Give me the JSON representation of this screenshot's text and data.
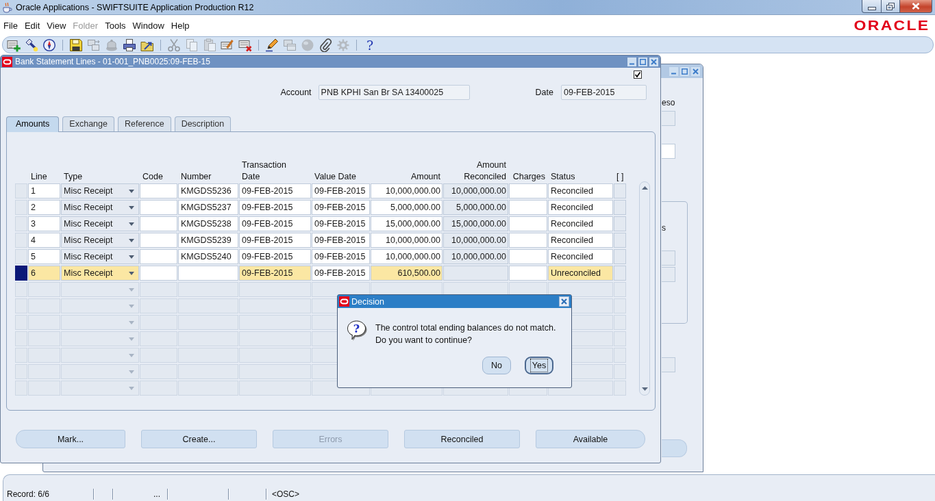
{
  "window": {
    "title": "Oracle Applications - SWIFTSUITE Application Production R12"
  },
  "menu": [
    {
      "label": "File",
      "disabled": false
    },
    {
      "label": "Edit",
      "disabled": false
    },
    {
      "label": "View",
      "disabled": false
    },
    {
      "label": "Folder",
      "disabled": true
    },
    {
      "label": "Tools",
      "disabled": false
    },
    {
      "label": "Window",
      "disabled": false
    },
    {
      "label": "Help",
      "disabled": false
    }
  ],
  "brand": "ORACLE",
  "toolbar": [
    {
      "buttons": [
        {
          "kind": "new",
          "disabled": false
        },
        {
          "kind": "find",
          "disabled": false
        },
        {
          "kind": "navigator",
          "disabled": false
        }
      ]
    },
    {
      "buttons": [
        {
          "kind": "save",
          "disabled": false
        },
        {
          "kind": "step",
          "disabled": true
        },
        {
          "kind": "responsibility",
          "disabled": true
        },
        {
          "kind": "print",
          "disabled": false
        },
        {
          "kind": "close",
          "disabled": false
        }
      ]
    },
    {
      "buttons": [
        {
          "kind": "cut",
          "disabled": true
        },
        {
          "kind": "copy",
          "disabled": true
        },
        {
          "kind": "paste",
          "disabled": true
        },
        {
          "kind": "clear",
          "disabled": false
        },
        {
          "kind": "delete",
          "disabled": false
        }
      ]
    },
    {
      "buttons": [
        {
          "kind": "edit",
          "disabled": false
        },
        {
          "kind": "zoom",
          "disabled": true
        },
        {
          "kind": "translate",
          "disabled": true
        },
        {
          "kind": "attach",
          "disabled": false
        },
        {
          "kind": "folder",
          "disabled": true
        }
      ]
    },
    {
      "buttons": [
        {
          "kind": "help",
          "disabled": false,
          "symbol": "?"
        }
      ]
    }
  ],
  "background_window": {
    "field_label": "eso",
    "panel_label": "s"
  },
  "form": {
    "title": "Bank Statement Lines - 01-001_PNB0025:09-FEB-15",
    "active": false,
    "checkbox": {
      "checked": true
    },
    "account": {
      "label": "Account",
      "value": "PNB KPHI San Br SA 13400025"
    },
    "date": {
      "label": "Date",
      "value": "09-FEB-2015"
    },
    "tabs": [
      {
        "label": "Amounts",
        "selected": true
      },
      {
        "label": "Exchange",
        "selected": false
      },
      {
        "label": "Reference",
        "selected": false
      },
      {
        "label": "Description",
        "selected": false
      }
    ],
    "table": {
      "columns": [
        {
          "label": "Line",
          "kind": "text",
          "required": true,
          "read_only": false
        },
        {
          "label": "Type",
          "kind": "list",
          "required": true,
          "read_only": false
        },
        {
          "label": "Code",
          "kind": "text",
          "required": false,
          "read_only": false
        },
        {
          "label": "Number",
          "kind": "text",
          "required": false,
          "read_only": false
        },
        {
          "label": "Transaction\nDate",
          "kind": "text",
          "required": true,
          "read_only": false
        },
        {
          "label": "Value Date",
          "kind": "text",
          "required": false,
          "read_only": false
        },
        {
          "label": "Amount",
          "kind": "number",
          "required": true,
          "read_only": false
        },
        {
          "label": "Amount\nReconciled",
          "kind": "number",
          "required": false,
          "read_only": true
        },
        {
          "label": "Charges",
          "kind": "number",
          "required": false,
          "read_only": false
        },
        {
          "label": "Status",
          "kind": "text",
          "required": true,
          "read_only": false
        },
        {
          "label": "[ ]",
          "kind": "text",
          "required": false,
          "read_only": true
        }
      ],
      "rows": [
        {
          "selected": false,
          "line": "1",
          "type": "Misc Receipt",
          "number": "KMGDS5236",
          "transaction_date": "09-FEB-2015",
          "value_date": "09-FEB-2015",
          "amount": "10,000,000.00",
          "amount_reconciled": "10,000,000.00",
          "status": "Reconciled"
        },
        {
          "selected": false,
          "line": "2",
          "type": "Misc Receipt",
          "number": "KMGDS5237",
          "transaction_date": "09-FEB-2015",
          "value_date": "09-FEB-2015",
          "amount": "5,000,000.00",
          "amount_reconciled": "5,000,000.00",
          "status": "Reconciled"
        },
        {
          "selected": false,
          "line": "3",
          "type": "Misc Receipt",
          "number": "KMGDS5238",
          "transaction_date": "09-FEB-2015",
          "value_date": "09-FEB-2015",
          "amount": "15,000,000.00",
          "amount_reconciled": "15,000,000.00",
          "status": "Reconciled"
        },
        {
          "selected": false,
          "line": "4",
          "type": "Misc Receipt",
          "number": "KMGDS5239",
          "transaction_date": "09-FEB-2015",
          "value_date": "09-FEB-2015",
          "amount": "10,000,000.00",
          "amount_reconciled": "10,000,000.00",
          "status": "Reconciled"
        },
        {
          "selected": false,
          "line": "5",
          "type": "Misc Receipt",
          "number": "KMGDS5240",
          "transaction_date": "09-FEB-2015",
          "value_date": "09-FEB-2015",
          "amount": "10,000,000.00",
          "amount_reconciled": "10,000,000.00",
          "status": "Reconciled"
        },
        {
          "selected": true,
          "line": "6",
          "type": "Misc Receipt",
          "transaction_date": "09-FEB-2015",
          "value_date": "09-FEB-2015",
          "amount": "610,500.00",
          "status": "Unreconciled"
        }
      ]
    },
    "buttons": [
      {
        "label": "Mark...",
        "disabled": false
      },
      {
        "label": "Create...",
        "disabled": false
      },
      {
        "label": "Errors",
        "disabled": true
      },
      {
        "label": "Reconciled",
        "disabled": false
      },
      {
        "label": "Available",
        "disabled": false
      }
    ]
  },
  "dialog": {
    "title": "Decision",
    "symbol": "?",
    "message": "The control total ending balances do not match.\nDo you want to continue?",
    "buttons": [
      {
        "label": "No",
        "focused": false
      },
      {
        "label": "Yes",
        "focused": true
      }
    ]
  },
  "status_bar": {
    "record": "Record: 6/6",
    "indicator": "...",
    "mode": "<OSC>"
  }
}
